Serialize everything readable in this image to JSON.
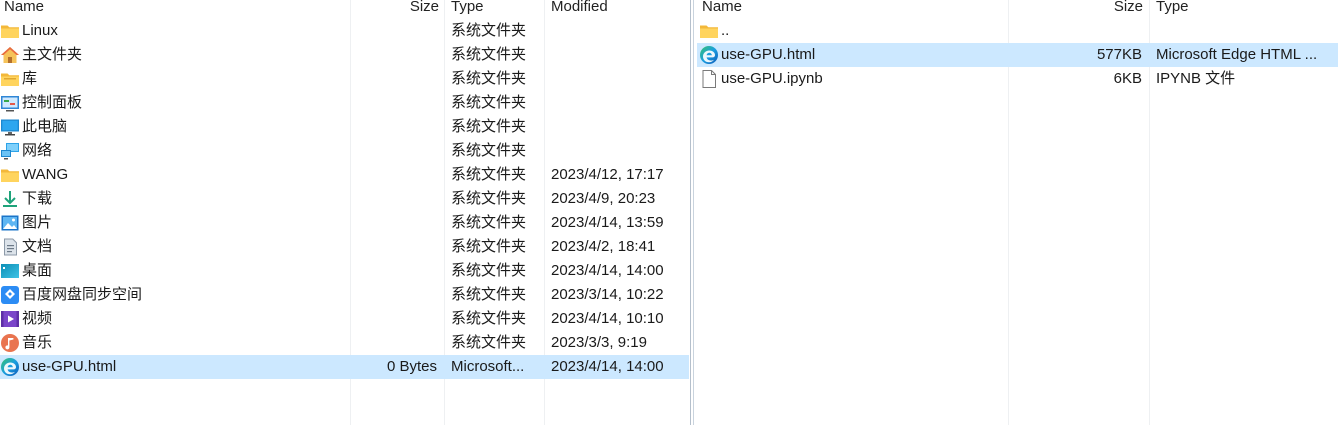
{
  "left_pane": {
    "columns": {
      "name": "Name",
      "size": "Size",
      "type": "Type",
      "modified": "Modified"
    },
    "rows": [
      {
        "name": "Linux",
        "size": "",
        "type": "系统文件夹",
        "modified": "",
        "icon": "folder-icon",
        "selected": false
      },
      {
        "name": "主文件夹",
        "size": "",
        "type": "系统文件夹",
        "modified": "",
        "icon": "home-icon",
        "selected": false
      },
      {
        "name": "库",
        "size": "",
        "type": "系统文件夹",
        "modified": "",
        "icon": "library-folder-icon",
        "selected": false
      },
      {
        "name": "控制面板",
        "size": "",
        "type": "系统文件夹",
        "modified": "",
        "icon": "control-panel-icon",
        "selected": false
      },
      {
        "name": "此电脑",
        "size": "",
        "type": "系统文件夹",
        "modified": "",
        "icon": "computer-icon",
        "selected": false
      },
      {
        "name": "网络",
        "size": "",
        "type": "系统文件夹",
        "modified": "",
        "icon": "network-icon",
        "selected": false
      },
      {
        "name": "WANG",
        "size": "",
        "type": "系统文件夹",
        "modified": "2023/4/12, 17:17",
        "icon": "folder-icon",
        "selected": false
      },
      {
        "name": "下载",
        "size": "",
        "type": "系统文件夹",
        "modified": "2023/4/9, 20:23",
        "icon": "download-icon",
        "selected": false
      },
      {
        "name": "图片",
        "size": "",
        "type": "系统文件夹",
        "modified": "2023/4/14, 13:59",
        "icon": "pictures-icon",
        "selected": false
      },
      {
        "name": "文档",
        "size": "",
        "type": "系统文件夹",
        "modified": "2023/4/2, 18:41",
        "icon": "documents-icon",
        "selected": false
      },
      {
        "name": "桌面",
        "size": "",
        "type": "系统文件夹",
        "modified": "2023/4/14, 14:00",
        "icon": "desktop-icon",
        "selected": false
      },
      {
        "name": "百度网盘同步空间",
        "size": "",
        "type": "系统文件夹",
        "modified": "2023/3/14, 10:22",
        "icon": "baidu-netdisk-icon",
        "selected": false
      },
      {
        "name": "视频",
        "size": "",
        "type": "系统文件夹",
        "modified": "2023/4/14, 10:10",
        "icon": "videos-icon",
        "selected": false
      },
      {
        "name": "音乐",
        "size": "",
        "type": "系统文件夹",
        "modified": "2023/3/3, 9:19",
        "icon": "music-icon",
        "selected": false
      },
      {
        "name": "use-GPU.html",
        "size": "0 Bytes",
        "type": "Microsoft...",
        "modified": "2023/4/14, 14:00",
        "icon": "edge-icon",
        "selected": true
      }
    ]
  },
  "right_pane": {
    "columns": {
      "name": "Name",
      "size": "Size",
      "type": "Type"
    },
    "rows": [
      {
        "name": "..",
        "size": "",
        "type": "",
        "icon": "folder-icon",
        "selected": false
      },
      {
        "name": "use-GPU.html",
        "size": "577KB",
        "type": "Microsoft Edge HTML ...",
        "icon": "edge-icon",
        "selected": true
      },
      {
        "name": "use-GPU.ipynb",
        "size": "6KB",
        "type": "IPYNB 文件",
        "icon": "file-icon",
        "selected": false
      }
    ]
  },
  "colors": {
    "selection": "#cce8ff",
    "folder": "#f8c948",
    "edge_blue": "#0c78d4",
    "edge_green": "#37c46b"
  }
}
